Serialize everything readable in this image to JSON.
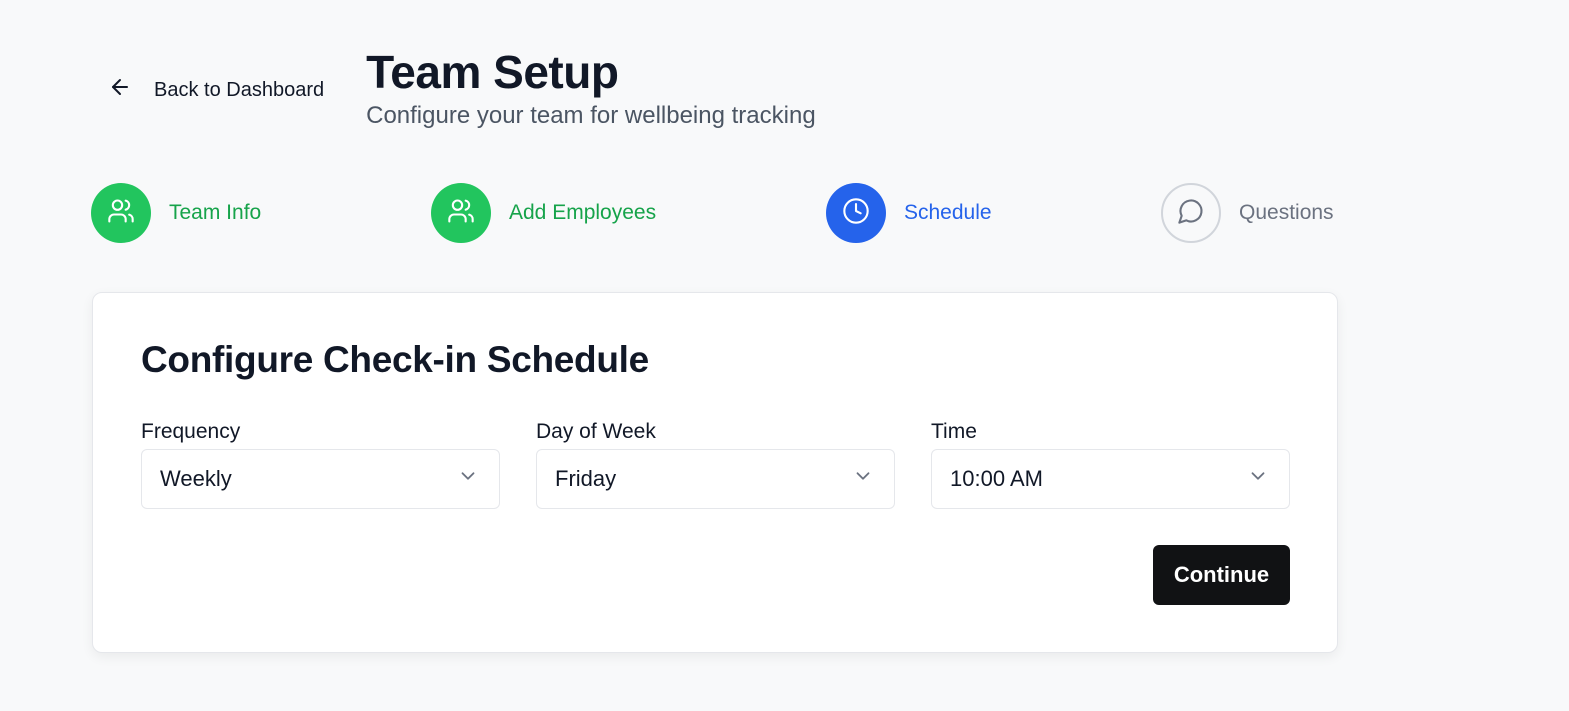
{
  "header": {
    "back_label": "Back to Dashboard",
    "title": "Team Setup",
    "subtitle": "Configure your team for wellbeing tracking"
  },
  "steps": [
    {
      "label": "Team Info",
      "status": "complete",
      "icon": "users-icon"
    },
    {
      "label": "Add Employees",
      "status": "complete",
      "icon": "users-icon"
    },
    {
      "label": "Schedule",
      "status": "active",
      "icon": "clock-icon"
    },
    {
      "label": "Questions",
      "status": "pending",
      "icon": "message-circle-icon"
    }
  ],
  "card": {
    "title": "Configure Check-in Schedule",
    "fields": [
      {
        "label": "Frequency",
        "value": "Weekly"
      },
      {
        "label": "Day of Week",
        "value": "Friday"
      },
      {
        "label": "Time",
        "value": "10:00 AM"
      }
    ],
    "continue_label": "Continue"
  },
  "colors": {
    "complete": "#22c55e",
    "active": "#2563eb",
    "pending_border": "#d1d5db",
    "primary_button": "#111214"
  }
}
